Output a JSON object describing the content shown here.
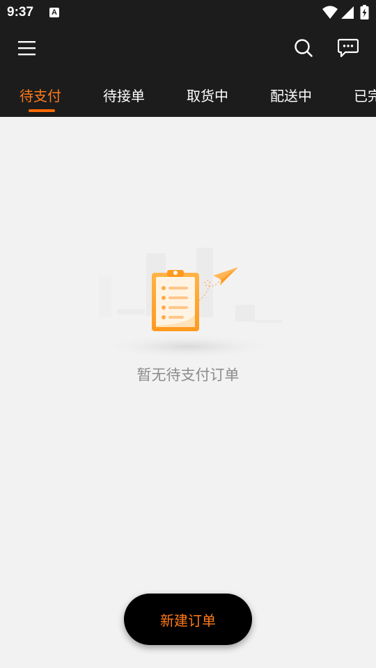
{
  "status_bar": {
    "time": "9:37",
    "notification_icon": "a-box-icon",
    "icons": [
      "wifi-icon",
      "signal-icon",
      "battery-charging-icon"
    ]
  },
  "header": {
    "menu_icon": "hamburger-menu-icon",
    "search_icon": "search-icon",
    "message_icon": "chat-bubble-icon"
  },
  "tabs": [
    {
      "label": "待支付",
      "active": true
    },
    {
      "label": "待接单",
      "active": false
    },
    {
      "label": "取货中",
      "active": false
    },
    {
      "label": "配送中",
      "active": false
    },
    {
      "label": "已完",
      "active": false
    }
  ],
  "empty_state": {
    "illustration": "clipboard-paper-plane-illustration",
    "message": "暂无待支付订单"
  },
  "fab": {
    "label": "新建订单"
  },
  "colors": {
    "header_bg": "#1c1c1c",
    "accent": "#ff7a1a",
    "page_bg": "#f2f2f2",
    "muted_text": "#8c8c8c",
    "fab_bg": "#000000"
  }
}
